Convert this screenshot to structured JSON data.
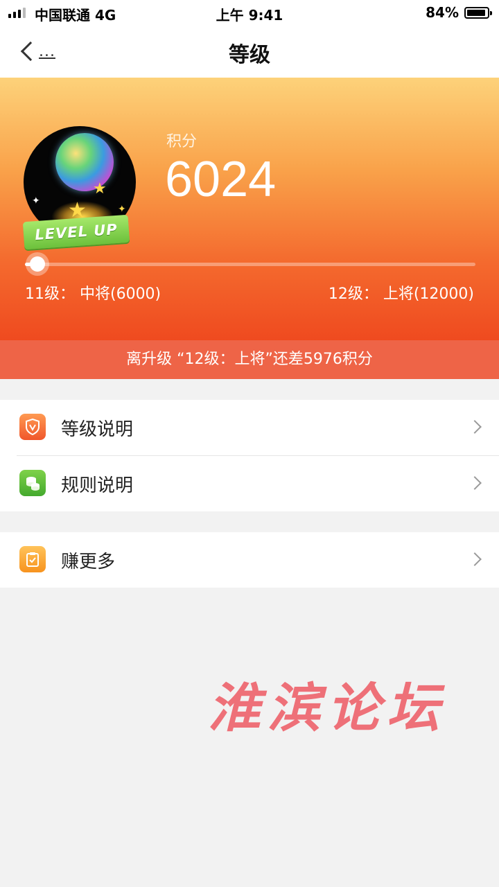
{
  "status_bar": {
    "carrier": "中国联通  4G",
    "time": "上午 9:41",
    "battery": "84%"
  },
  "nav": {
    "back_label": "...",
    "title": "等级"
  },
  "hero": {
    "badge_text": "LEVEL UP",
    "score_label": "积分",
    "score_value": "6024",
    "progress_fraction": 0.004,
    "current_level": "11级： 中将(6000)",
    "next_level": "12级： 上将(12000)",
    "hint": "离升级 “12级：上将”还差5976积分"
  },
  "menu": {
    "group1": [
      {
        "label": "等级说明",
        "icon": "shield-v-icon"
      },
      {
        "label": "规则说明",
        "icon": "coins-icon"
      }
    ],
    "group2": [
      {
        "label": "赚更多",
        "icon": "clipboard-check-icon"
      }
    ]
  },
  "watermark": "淮滨论坛",
  "colors": {
    "hero_top": "#fdd27a",
    "hero_bottom": "#ef4a1f",
    "hint_strip": "#ee6447",
    "watermark": "#ee6a72"
  }
}
